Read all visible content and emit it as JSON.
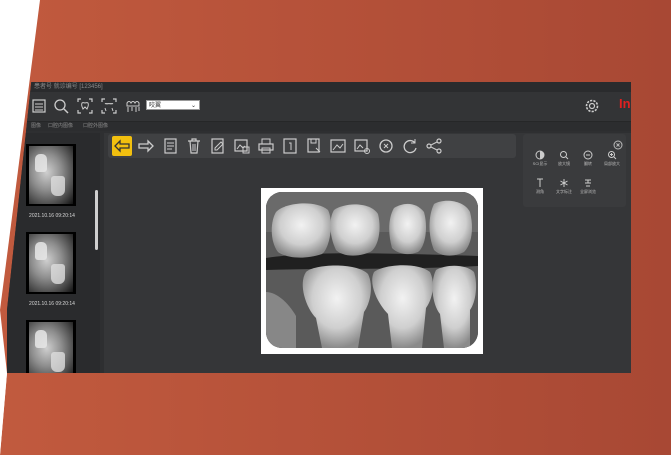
{
  "window": {
    "title_text": "患者号  就诊编号  [123456]",
    "brand": "In",
    "exam_select": {
      "value": "咬翼"
    }
  },
  "tabs": [
    "图像",
    "口腔内图像",
    "口腔外图像"
  ],
  "thumbnails": [
    {
      "label": "2021.10.16 09:20:14"
    },
    {
      "label": "2021.10.16 09:20:14"
    },
    {
      "label": ""
    }
  ],
  "panel": {
    "items": [
      "SCI显示",
      "放大镜",
      "翻转",
      "局部放大",
      "测角",
      "文字标注",
      "全屏浏览"
    ]
  },
  "colors": {
    "background": "#b6503a",
    "window": "#2e2f31",
    "accent_active": "#f2c00f",
    "brand": "#e02020"
  }
}
